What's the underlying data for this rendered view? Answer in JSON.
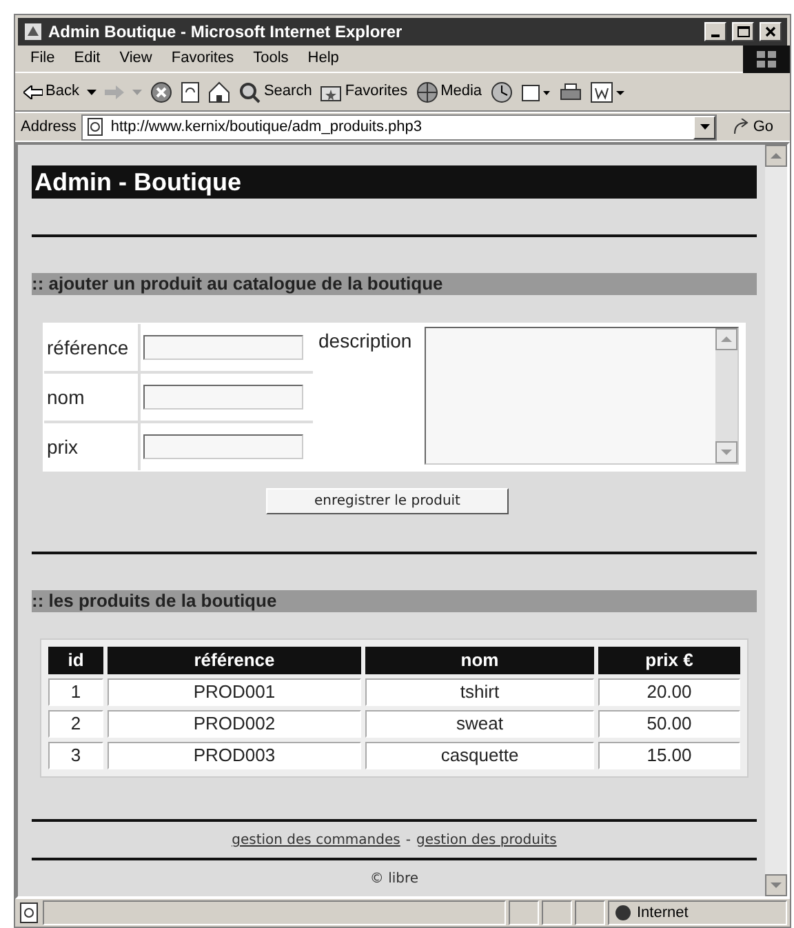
{
  "window": {
    "title": "Admin Boutique - Microsoft Internet Explorer"
  },
  "menu": [
    "File",
    "Edit",
    "View",
    "Favorites",
    "Tools",
    "Help"
  ],
  "toolbar": {
    "back": "Back",
    "search": "Search",
    "favorites": "Favorites",
    "media": "Media"
  },
  "address": {
    "label": "Address",
    "url": "http://www.kernix/boutique/adm_produits.php3",
    "go": "Go"
  },
  "page": {
    "heading": "Admin - Boutique",
    "form_section": ":: ajouter un produit au catalogue de la boutique",
    "fields": [
      {
        "label": "référence"
      },
      {
        "label": "nom"
      },
      {
        "label": "prix"
      }
    ],
    "description_label": "description",
    "submit": "enregistrer le produit",
    "list_section": ":: les produits de la boutique",
    "table": {
      "columns": [
        "id",
        "référence",
        "nom",
        "prix €"
      ],
      "rows": [
        [
          "1",
          "PROD001",
          "tshirt",
          "20.00"
        ],
        [
          "2",
          "PROD002",
          "sweat",
          "50.00"
        ],
        [
          "3",
          "PROD003",
          "casquette",
          "15.00"
        ]
      ]
    },
    "footer_links": [
      "gestion des commandes",
      "gestion des produits"
    ],
    "separator": "-",
    "copyright": "© libre"
  },
  "status_bar": {
    "zone": "Internet"
  }
}
